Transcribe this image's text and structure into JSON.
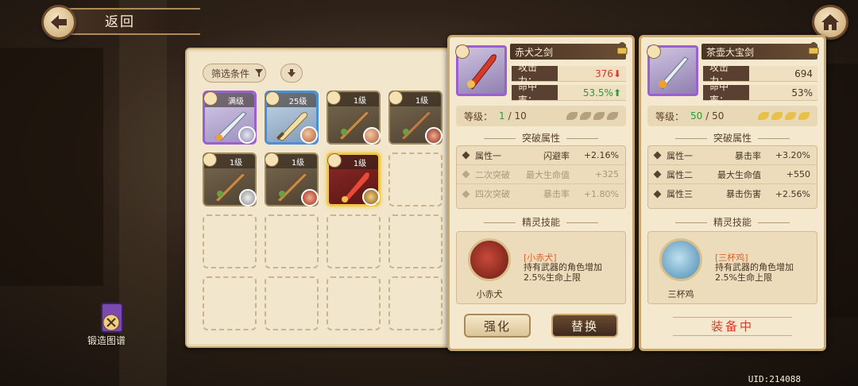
{
  "header": {
    "back_label": "返回"
  },
  "inventory": {
    "filter_label": "筛选条件",
    "slots": [
      {
        "level": "满级",
        "rarity": "purple"
      },
      {
        "level": "25级",
        "rarity": "blue"
      },
      {
        "level": "1级",
        "rarity": "normal"
      },
      {
        "level": "1级",
        "rarity": "normal"
      },
      {
        "level": "1级",
        "rarity": "normal"
      },
      {
        "level": "1级",
        "rarity": "normal"
      },
      {
        "level": "1级",
        "rarity": "selected"
      }
    ]
  },
  "forge": {
    "label": "锻造图谱"
  },
  "selected_weapon": {
    "name": "赤犬之剑",
    "attack_label": "攻击力：",
    "attack_value": "376",
    "hit_label": "命中率：",
    "hit_value": "53.5%",
    "level_label": "等级：",
    "level_current": "1",
    "level_max": "/ 10",
    "breakthrough_title": "突破属性",
    "attributes": [
      {
        "name": "属性一",
        "type": "闪避率",
        "value": "+2.16%"
      },
      {
        "name": "二次突破",
        "type": "最大生命值",
        "value": "+325"
      },
      {
        "name": "四次突破",
        "type": "暴击率",
        "value": "+1.80%"
      }
    ],
    "spirit_title": "精灵技能",
    "skill_title": "[小赤犬]",
    "skill_desc": "持有武器的角色增加2.5%生命上限",
    "skill_name": "小赤犬",
    "strengthen_label": "强化",
    "replace_label": "替换"
  },
  "equipped_weapon": {
    "name": "茶壶大宝剑",
    "attack_label": "攻击力：",
    "attack_value": "694",
    "hit_label": "命中率：",
    "hit_value": "53%",
    "level_label": "等级：",
    "level_current": "50",
    "level_max": "/ 50",
    "breakthrough_title": "突破属性",
    "attributes": [
      {
        "name": "属性一",
        "type": "暴击率",
        "value": "+3.20%"
      },
      {
        "name": "属性二",
        "type": "最大生命值",
        "value": "+550"
      },
      {
        "name": "属性三",
        "type": "暴击伤害",
        "value": "+2.56%"
      }
    ],
    "spirit_title": "精灵技能",
    "skill_title": "[三杯鸡]",
    "skill_desc": "持有武器的角色增加2.5%生命上限",
    "skill_name": "三杯鸡",
    "equipped_label": "装备中"
  },
  "footer": {
    "uid": "UID:214088"
  },
  "colors": {
    "accent_purple": "#9a5fd0",
    "accent_blue": "#4a8fd8",
    "selected_gold": "#f2c84a",
    "down_red": "#d83a2a",
    "up_green": "#2f9a3a"
  }
}
